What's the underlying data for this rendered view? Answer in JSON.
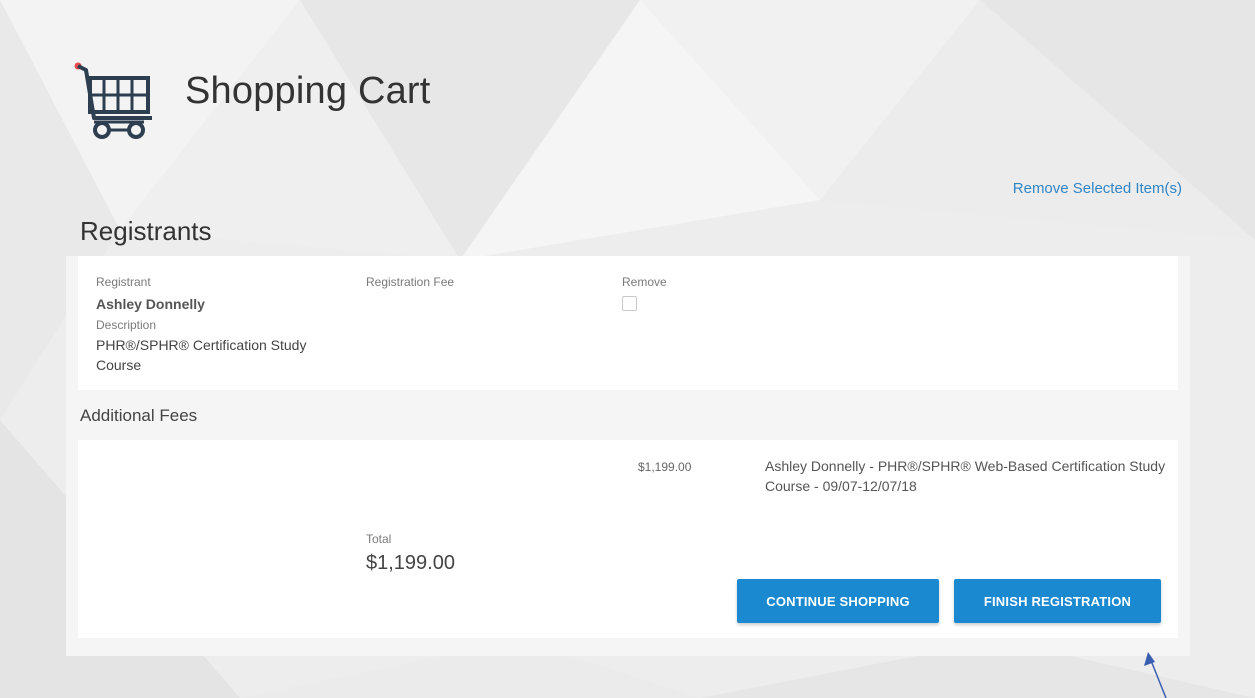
{
  "page": {
    "title": "Shopping Cart",
    "remove_selected_label": "Remove Selected Item(s)"
  },
  "icons": {
    "cart": "shopping-cart-icon",
    "pointer": "arrow-pointer-icon"
  },
  "registrants": {
    "section_title": "Registrants",
    "headers": {
      "registrant": "Registrant",
      "registration_fee": "Registration Fee",
      "remove": "Remove",
      "description": "Description"
    },
    "items": [
      {
        "name": "Ashley Donnelly",
        "description_line1": "PHR®/SPHR® Certification Study",
        "description_line2": "Course",
        "remove_checked": false
      }
    ]
  },
  "additional_fees": {
    "section_title": "Additional Fees",
    "items": [
      {
        "amount": "$1,199.00",
        "description": "Ashley Donnelly - PHR®/SPHR® Web-Based Certification Study Course - 09/07-12/07/18"
      }
    ]
  },
  "total": {
    "label": "Total",
    "value": "$1,199.00"
  },
  "buttons": {
    "continue_shopping": "CONTINUE SHOPPING",
    "finish_registration": "FINISH REGISTRATION"
  },
  "colors": {
    "accent": "#1a89d0",
    "link": "#2f86c6",
    "background": "#ececed",
    "brand_red": "#e84b4b"
  }
}
